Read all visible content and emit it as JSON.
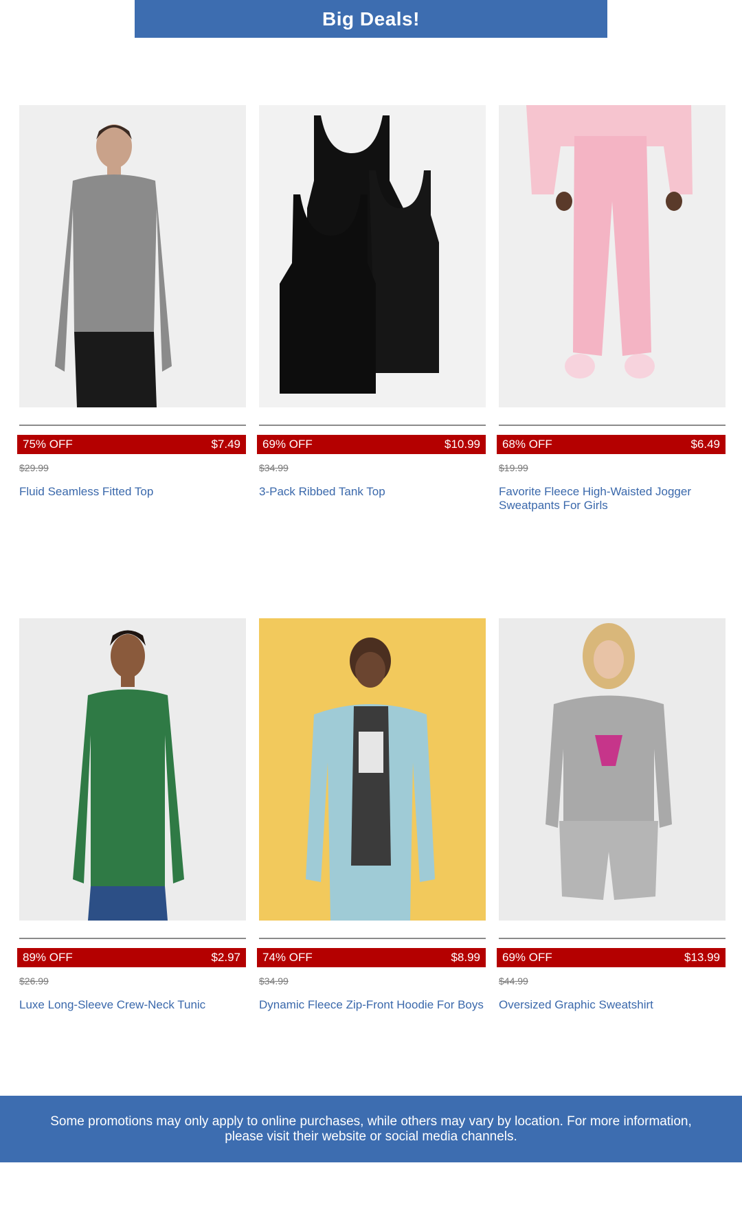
{
  "banner": {
    "title": "Big Deals!"
  },
  "products": [
    {
      "discount": "75% OFF",
      "price": "$7.49",
      "original_price": "$29.99",
      "name": "Fluid Seamless Fitted Top"
    },
    {
      "discount": "69% OFF",
      "price": "$10.99",
      "original_price": "$34.99",
      "name": "3-Pack Ribbed Tank Top"
    },
    {
      "discount": "68% OFF",
      "price": "$6.49",
      "original_price": "$19.99",
      "name": "Favorite Fleece High-Waisted Jogger Sweatpants For Girls"
    },
    {
      "discount": "89% OFF",
      "price": "$2.97",
      "original_price": "$26.99",
      "name": "Luxe Long-Sleeve Crew-Neck Tunic"
    },
    {
      "discount": "74% OFF",
      "price": "$8.99",
      "original_price": "$34.99",
      "name": "Dynamic Fleece Zip-Front Hoodie For Boys"
    },
    {
      "discount": "69% OFF",
      "price": "$13.99",
      "original_price": "$44.99",
      "name": "Oversized Graphic Sweatshirt"
    }
  ],
  "footer": {
    "text": "Some promotions may only apply to online purchases, while others may vary by location. For more information, please visit their website or social media channels."
  },
  "colors": {
    "brand_blue": "#3d6db0",
    "sale_red": "#b40000",
    "link_blue": "#3a68ab"
  }
}
